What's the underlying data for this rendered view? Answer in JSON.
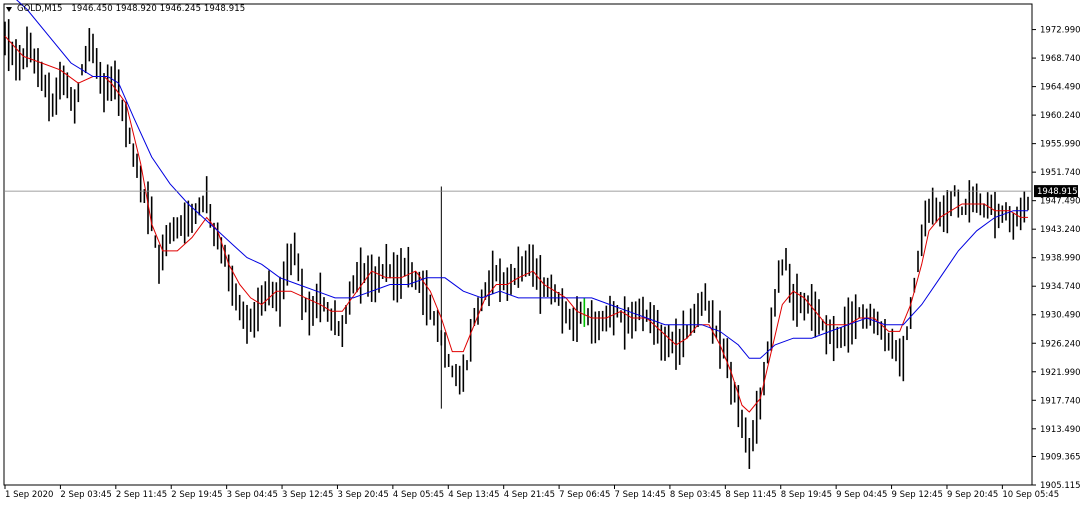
{
  "window": {
    "symbol": "GOLD,M15",
    "ohlc": "1946.450 1948.920 1946.245 1948.915"
  },
  "colors": {
    "background": "#ffffff",
    "frame": "#000000",
    "candles": "#000000",
    "highlight_bar": "#00c000",
    "fast_ma": "#e00000",
    "slow_ma": "#0000e0",
    "bid_line": "#808080"
  },
  "chart_data": {
    "type": "line",
    "ylim": [
      1905.115,
      1976.8
    ],
    "y_ticks": [
      "1972.990",
      "1968.740",
      "1964.490",
      "1960.240",
      "1955.990",
      "1951.740",
      "1947.490",
      "1943.240",
      "1938.990",
      "1934.740",
      "1930.490",
      "1926.240",
      "1921.990",
      "1917.740",
      "1913.490",
      "1909.365",
      "1905.115"
    ],
    "x_tick_labels": [
      "1 Sep 2020",
      "2 Sep 03:45",
      "2 Sep 11:45",
      "2 Sep 19:45",
      "3 Sep 04:45",
      "3 Sep 12:45",
      "3 Sep 20:45",
      "4 Sep 05:45",
      "4 Sep 13:45",
      "4 Sep 21:45",
      "7 Sep 06:45",
      "7 Sep 14:45",
      "8 Sep 03:45",
      "8 Sep 11:45",
      "8 Sep 19:45",
      "9 Sep 04:45",
      "9 Sep 12:45",
      "9 Sep 20:45",
      "10 Sep 05:45"
    ],
    "current_price_label": "1948.915",
    "current_price": 1948.915,
    "price_path": [
      [
        0,
        1972
      ],
      [
        3,
        1968
      ],
      [
        7,
        1970
      ],
      [
        10,
        1966
      ],
      [
        13,
        1962
      ],
      [
        16,
        1966
      ],
      [
        19,
        1961
      ],
      [
        21,
        1967
      ],
      [
        23,
        1971
      ],
      [
        25,
        1968
      ],
      [
        27,
        1964
      ],
      [
        30,
        1965
      ],
      [
        33,
        1959
      ],
      [
        37,
        1950
      ],
      [
        40,
        1945
      ],
      [
        42,
        1938
      ],
      [
        44,
        1942
      ],
      [
        48,
        1944
      ],
      [
        52,
        1946
      ],
      [
        55,
        1948
      ],
      [
        57,
        1943
      ],
      [
        60,
        1939
      ],
      [
        63,
        1933
      ],
      [
        66,
        1929
      ],
      [
        69,
        1931
      ],
      [
        72,
        1935
      ],
      [
        75,
        1932
      ],
      [
        77,
        1938
      ],
      [
        79,
        1941
      ],
      [
        81,
        1934
      ],
      [
        83,
        1930
      ],
      [
        86,
        1933
      ],
      [
        89,
        1930
      ],
      [
        92,
        1928
      ],
      [
        95,
        1935
      ],
      [
        98,
        1937
      ],
      [
        101,
        1935
      ],
      [
        104,
        1938
      ],
      [
        107,
        1936
      ],
      [
        110,
        1938
      ],
      [
        113,
        1935
      ],
      [
        116,
        1932
      ],
      [
        119,
        1927
      ],
      [
        122,
        1922
      ],
      [
        124,
        1920
      ],
      [
        126,
        1923
      ],
      [
        128,
        1930
      ],
      [
        131,
        1934
      ],
      [
        134,
        1937
      ],
      [
        137,
        1935
      ],
      [
        140,
        1937
      ],
      [
        143,
        1939
      ],
      [
        146,
        1935
      ],
      [
        149,
        1934
      ],
      [
        152,
        1932
      ],
      [
        155,
        1929
      ],
      [
        158,
        1931
      ],
      [
        161,
        1928
      ],
      [
        164,
        1930
      ],
      [
        167,
        1931
      ],
      [
        170,
        1929
      ],
      [
        173,
        1931
      ],
      [
        176,
        1930
      ],
      [
        179,
        1927
      ],
      [
        182,
        1926
      ],
      [
        185,
        1927
      ],
      [
        188,
        1930
      ],
      [
        191,
        1933
      ],
      [
        194,
        1928
      ],
      [
        197,
        1924
      ],
      [
        199,
        1919
      ],
      [
        201,
        1914
      ],
      [
        203,
        1910
      ],
      [
        205,
        1915
      ],
      [
        207,
        1921
      ],
      [
        209,
        1929
      ],
      [
        211,
        1936
      ],
      [
        213,
        1939
      ],
      [
        215,
        1933
      ],
      [
        218,
        1932
      ],
      [
        221,
        1931
      ],
      [
        224,
        1928
      ],
      [
        227,
        1927
      ],
      [
        230,
        1929
      ],
      [
        233,
        1931
      ],
      [
        236,
        1930
      ],
      [
        239,
        1928
      ],
      [
        242,
        1926
      ],
      [
        245,
        1924
      ],
      [
        247,
        1931
      ],
      [
        249,
        1938
      ],
      [
        251,
        1944
      ],
      [
        253,
        1947
      ],
      [
        255,
        1945
      ],
      [
        257,
        1946
      ],
      [
        259,
        1949
      ],
      [
        261,
        1946
      ],
      [
        263,
        1947
      ],
      [
        265,
        1948
      ],
      [
        267,
        1946
      ],
      [
        269,
        1947
      ],
      [
        271,
        1945
      ],
      [
        273,
        1946
      ],
      [
        275,
        1944
      ],
      [
        277,
        1946
      ],
      [
        279,
        1947
      ]
    ],
    "series": [
      {
        "color": "#e00000",
        "points": [
          [
            0,
            1972
          ],
          [
            5,
            1969
          ],
          [
            10,
            1968
          ],
          [
            15,
            1967
          ],
          [
            20,
            1965
          ],
          [
            24,
            1966
          ],
          [
            27,
            1966
          ],
          [
            29,
            1965
          ],
          [
            33,
            1962
          ],
          [
            37,
            1953
          ],
          [
            40,
            1944
          ],
          [
            43,
            1940
          ],
          [
            47,
            1940
          ],
          [
            51,
            1942
          ],
          [
            55,
            1945
          ],
          [
            58,
            1943
          ],
          [
            61,
            1938
          ],
          [
            64,
            1935
          ],
          [
            67,
            1933
          ],
          [
            70,
            1932
          ],
          [
            74,
            1934
          ],
          [
            78,
            1934
          ],
          [
            82,
            1933
          ],
          [
            86,
            1932
          ],
          [
            89,
            1931
          ],
          [
            92,
            1931
          ],
          [
            96,
            1934
          ],
          [
            100,
            1937
          ],
          [
            104,
            1936
          ],
          [
            108,
            1936
          ],
          [
            112,
            1937
          ],
          [
            116,
            1934
          ],
          [
            119,
            1930
          ],
          [
            122,
            1925
          ],
          [
            125,
            1925
          ],
          [
            128,
            1929
          ],
          [
            131,
            1933
          ],
          [
            134,
            1935
          ],
          [
            137,
            1935
          ],
          [
            140,
            1936
          ],
          [
            144,
            1937
          ],
          [
            147,
            1935
          ],
          [
            150,
            1934
          ],
          [
            153,
            1933
          ],
          [
            156,
            1931
          ],
          [
            160,
            1930
          ],
          [
            164,
            1930
          ],
          [
            168,
            1931
          ],
          [
            171,
            1930
          ],
          [
            175,
            1930
          ],
          [
            179,
            1928
          ],
          [
            183,
            1926
          ],
          [
            186,
            1927
          ],
          [
            189,
            1929
          ],
          [
            192,
            1929
          ],
          [
            195,
            1926
          ],
          [
            198,
            1922
          ],
          [
            201,
            1917
          ],
          [
            203,
            1916
          ],
          [
            206,
            1918
          ],
          [
            209,
            1925
          ],
          [
            212,
            1932
          ],
          [
            215,
            1934
          ],
          [
            218,
            1933
          ],
          [
            221,
            1931
          ],
          [
            224,
            1929
          ],
          [
            227,
            1929
          ],
          [
            230,
            1929
          ],
          [
            233,
            1930
          ],
          [
            237,
            1930
          ],
          [
            241,
            1928
          ],
          [
            244,
            1928
          ],
          [
            247,
            1932
          ],
          [
            250,
            1938
          ],
          [
            252,
            1943
          ],
          [
            255,
            1945
          ],
          [
            258,
            1946
          ],
          [
            261,
            1947
          ],
          [
            264,
            1947
          ],
          [
            267,
            1947
          ],
          [
            270,
            1946
          ],
          [
            274,
            1946
          ],
          [
            277,
            1945
          ],
          [
            279,
            1945
          ]
        ]
      },
      {
        "color": "#0000e0",
        "points": [
          [
            0,
            1979
          ],
          [
            6,
            1976
          ],
          [
            12,
            1972
          ],
          [
            18,
            1968
          ],
          [
            24,
            1966
          ],
          [
            28,
            1966
          ],
          [
            31,
            1965
          ],
          [
            35,
            1960
          ],
          [
            40,
            1954
          ],
          [
            45,
            1950
          ],
          [
            50,
            1947
          ],
          [
            54,
            1945
          ],
          [
            58,
            1943
          ],
          [
            62,
            1941
          ],
          [
            66,
            1939
          ],
          [
            70,
            1938
          ],
          [
            75,
            1936
          ],
          [
            80,
            1935
          ],
          [
            85,
            1934
          ],
          [
            90,
            1933
          ],
          [
            95,
            1933
          ],
          [
            100,
            1934
          ],
          [
            105,
            1935
          ],
          [
            110,
            1935
          ],
          [
            115,
            1936
          ],
          [
            120,
            1936
          ],
          [
            125,
            1934
          ],
          [
            130,
            1933
          ],
          [
            135,
            1934
          ],
          [
            140,
            1933
          ],
          [
            145,
            1933
          ],
          [
            150,
            1933
          ],
          [
            155,
            1933
          ],
          [
            160,
            1933
          ],
          [
            165,
            1932
          ],
          [
            170,
            1931
          ],
          [
            175,
            1930
          ],
          [
            180,
            1929
          ],
          [
            185,
            1929
          ],
          [
            190,
            1929
          ],
          [
            195,
            1928
          ],
          [
            200,
            1926
          ],
          [
            203,
            1924
          ],
          [
            206,
            1924
          ],
          [
            210,
            1926
          ],
          [
            215,
            1927
          ],
          [
            220,
            1927
          ],
          [
            225,
            1928
          ],
          [
            230,
            1929
          ],
          [
            235,
            1930
          ],
          [
            240,
            1929
          ],
          [
            245,
            1929
          ],
          [
            250,
            1932
          ],
          [
            255,
            1936
          ],
          [
            260,
            1940
          ],
          [
            265,
            1943
          ],
          [
            270,
            1945
          ],
          [
            275,
            1946
          ],
          [
            279,
            1946
          ]
        ]
      }
    ]
  }
}
